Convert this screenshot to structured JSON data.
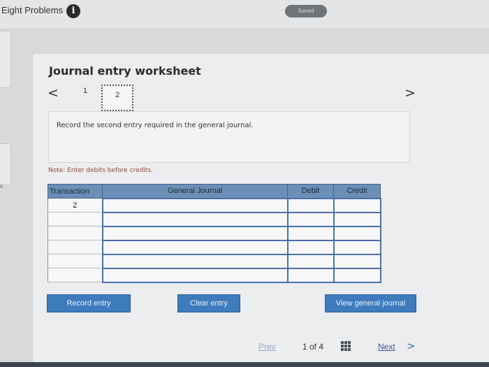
{
  "header": {
    "title": "Eight Problems",
    "info_icon": "i",
    "saved_label": "Saved"
  },
  "sidebar": {
    "mark": "s"
  },
  "worksheet": {
    "title": "Journal entry worksheet",
    "nav_prev": "<",
    "nav_next": ">",
    "steps": [
      "1",
      "2"
    ],
    "active_step": "2",
    "instruction": "Record the second entry required in the general journal.",
    "note": "Note: Enter debits before credits.",
    "table": {
      "headers": [
        "Transaction",
        "General Journal",
        "Debit",
        "Credit"
      ],
      "rows": [
        {
          "transaction": "2",
          "account": "",
          "debit": "",
          "credit": ""
        },
        {
          "transaction": "",
          "account": "",
          "debit": "",
          "credit": ""
        },
        {
          "transaction": "",
          "account": "",
          "debit": "",
          "credit": ""
        },
        {
          "transaction": "",
          "account": "",
          "debit": "",
          "credit": ""
        },
        {
          "transaction": "",
          "account": "",
          "debit": "",
          "credit": ""
        },
        {
          "transaction": "",
          "account": "",
          "debit": "",
          "credit": ""
        }
      ]
    },
    "buttons": {
      "record": "Record entry",
      "clear": "Clear entry",
      "view": "View general journal"
    }
  },
  "pager": {
    "prev": "Prev",
    "position": "1 of 4",
    "next": "Next",
    "next_chevron": ">"
  },
  "colors": {
    "header_blue": "#6b8fb7",
    "button_blue": "#3d7bbd",
    "note_red": "#8a4a3a"
  }
}
